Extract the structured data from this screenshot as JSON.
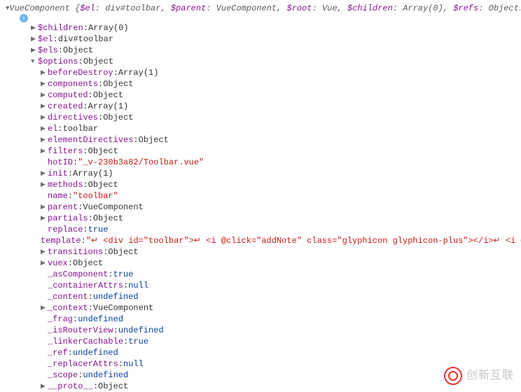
{
  "summary": {
    "type": "VueComponent",
    "parts": [
      {
        "k": "$el",
        "v": "div#toolbar"
      },
      {
        "k": "$parent",
        "v": "VueComponent"
      },
      {
        "k": "$root",
        "v": "Vue"
      },
      {
        "k": "$children",
        "v": "Array(0)"
      },
      {
        "k": "$refs",
        "v": "Object…"
      }
    ]
  },
  "info_tooltip": "i",
  "rows": [
    {
      "indent": 2,
      "expand": "closed",
      "key": "$children",
      "type": "Array(0)",
      "interact": true
    },
    {
      "indent": 2,
      "expand": "closed",
      "key": "$el",
      "type": "div#toolbar",
      "interact": true
    },
    {
      "indent": 2,
      "expand": "closed",
      "key": "$els",
      "type": "Object",
      "interact": true
    },
    {
      "indent": 2,
      "expand": "open",
      "key": "$options",
      "type": "Object",
      "interact": true
    },
    {
      "indent": 3,
      "expand": "closed",
      "key": "beforeDestroy",
      "type": "Array(1)",
      "interact": true
    },
    {
      "indent": 3,
      "expand": "closed",
      "key": "components",
      "type": "Object",
      "interact": true
    },
    {
      "indent": 3,
      "expand": "closed",
      "key": "computed",
      "type": "Object",
      "interact": true
    },
    {
      "indent": 3,
      "expand": "closed",
      "key": "created",
      "type": "Array(1)",
      "interact": true
    },
    {
      "indent": 3,
      "expand": "closed",
      "key": "directives",
      "type": "Object",
      "interact": true
    },
    {
      "indent": 3,
      "expand": "closed",
      "key": "el",
      "type": "toolbar",
      "interact": true
    },
    {
      "indent": 3,
      "expand": "closed",
      "key": "elementDirectives",
      "type": "Object",
      "interact": true
    },
    {
      "indent": 3,
      "expand": "closed",
      "key": "filters",
      "type": "Object",
      "interact": true
    },
    {
      "indent": 3,
      "expand": "none",
      "key": "hotID",
      "str": "\"_v-230b3a82/Toolbar.vue\"",
      "interact": false
    },
    {
      "indent": 3,
      "expand": "closed",
      "key": "init",
      "type": "Array(1)",
      "interact": true
    },
    {
      "indent": 3,
      "expand": "closed",
      "key": "methods",
      "type": "Object",
      "interact": true
    },
    {
      "indent": 3,
      "expand": "none",
      "key": "name",
      "str": "\"toolbar\"",
      "interact": false
    },
    {
      "indent": 3,
      "expand": "closed",
      "key": "parent",
      "type": "VueComponent",
      "interact": true
    },
    {
      "indent": 3,
      "expand": "closed",
      "key": "partials",
      "type": "Object",
      "interact": true
    },
    {
      "indent": 3,
      "expand": "none",
      "key": "replace",
      "val": "true",
      "interact": false
    },
    {
      "indent": 3,
      "expand": "none",
      "key": "template",
      "str": "\"↵   <div id=\"toolbar\">↵    <i @click=\"addNote\" class=\"glyphicon glyphicon-plus\"></i>↵    <i @c",
      "interact": false
    },
    {
      "indent": 3,
      "expand": "closed",
      "key": "transitions",
      "type": "Object",
      "interact": true
    },
    {
      "indent": 3,
      "expand": "closed",
      "key": "vuex",
      "type": "Object",
      "interact": true
    },
    {
      "indent": 3,
      "expand": "none",
      "key": "_asComponent",
      "val": "true",
      "interact": false
    },
    {
      "indent": 3,
      "expand": "none",
      "key": "_containerAttrs",
      "val": "null",
      "interact": false
    },
    {
      "indent": 3,
      "expand": "none",
      "key": "_content",
      "val": "undefined",
      "interact": false
    },
    {
      "indent": 3,
      "expand": "closed",
      "key": "_context",
      "type": "VueComponent",
      "interact": true
    },
    {
      "indent": 3,
      "expand": "none",
      "key": "_frag",
      "val": "undefined",
      "interact": false
    },
    {
      "indent": 3,
      "expand": "none",
      "key": "_isRouterView",
      "val": "undefined",
      "interact": false
    },
    {
      "indent": 3,
      "expand": "none",
      "key": "_linkerCachable",
      "val": "true",
      "interact": false
    },
    {
      "indent": 3,
      "expand": "none",
      "key": "_ref",
      "val": "undefined",
      "interact": false
    },
    {
      "indent": 3,
      "expand": "none",
      "key": "_replacerAttrs",
      "val": "null",
      "interact": false
    },
    {
      "indent": 3,
      "expand": "none",
      "key": "_scope",
      "val": "undefined",
      "interact": false
    },
    {
      "indent": 3,
      "expand": "closed",
      "key": "__proto__",
      "type": "Object",
      "interact": true
    }
  ],
  "watermark": "创新互联"
}
